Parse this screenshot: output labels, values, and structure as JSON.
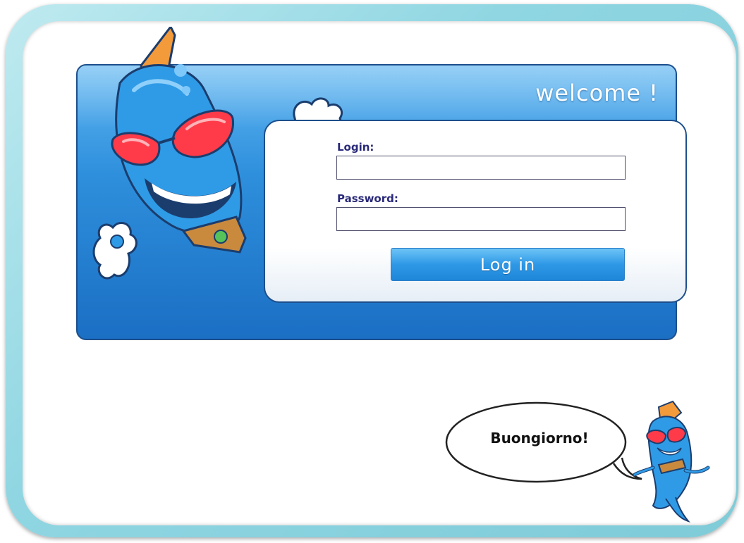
{
  "header": {
    "welcome": "welcome !"
  },
  "login_form": {
    "login_label": "Login:",
    "login_value": "",
    "password_label": "Password:",
    "password_value": "",
    "submit_label": "Log in"
  },
  "speech_bubble": {
    "text": "Buongiorno!"
  },
  "colors": {
    "frame": "#8fd6e2",
    "panel": "#2e8fdc",
    "label": "#2a2a7a",
    "button": "#2e98e6"
  },
  "icons": [
    "mascot-illustration",
    "small-mascot-illustration",
    "speech-bubble"
  ]
}
